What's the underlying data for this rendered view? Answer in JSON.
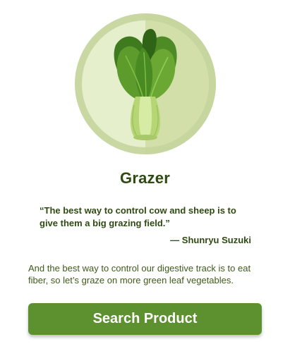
{
  "hero": {
    "icon": "bok-choy-icon",
    "colors": {
      "ring": "#c9d8a2",
      "disc_left": "#e6efcc",
      "disc_right": "#d2dfa9",
      "leaf_dark": "#3f7a1e",
      "leaf_mid": "#5d9b2c",
      "stem": "#c6df8a"
    }
  },
  "title": "Grazer",
  "quote": {
    "text": "“The best way to control cow and sheep is to give them a big grazing field.”",
    "author": "— Shunryu Suzuki"
  },
  "description": "And the best way to control our digestive track is to eat fiber, so let’s graze on more green leaf vegetables.",
  "cta": {
    "label": "Search Product",
    "color": "#5d9130"
  }
}
